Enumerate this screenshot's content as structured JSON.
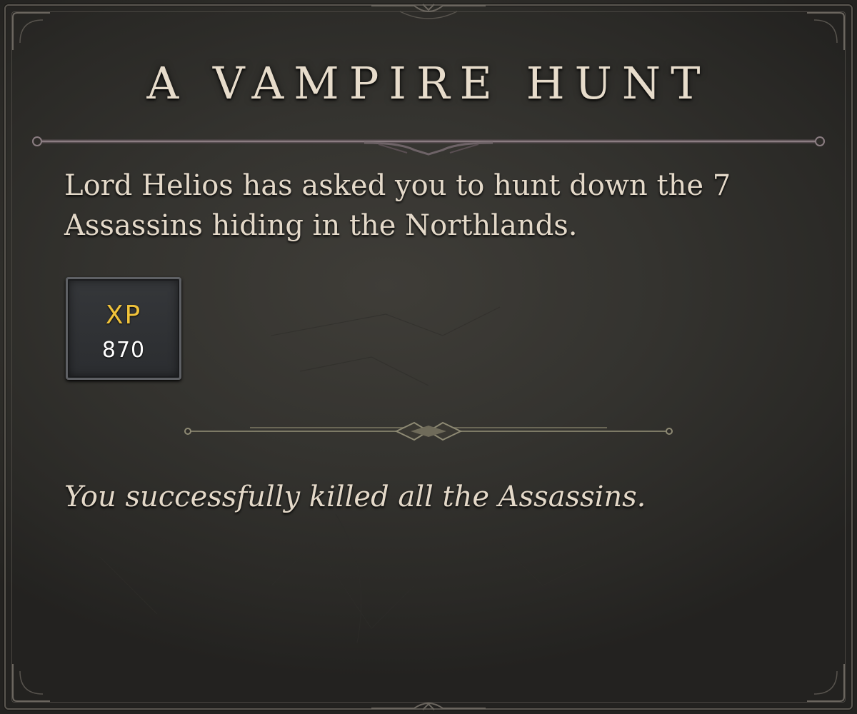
{
  "quest": {
    "title": "A VAMPIRE HUNT",
    "description": "Lord Helios has asked you to hunt down the 7 Assassins hiding in the Northlands.",
    "completion_text": "You successfully killed all the Assassins."
  },
  "reward": {
    "label": "XP",
    "value": "870",
    "label_color": "#f0c23a"
  },
  "colors": {
    "background": "#34332f",
    "text": "#e4d9c9",
    "frame": "#5a5650"
  }
}
